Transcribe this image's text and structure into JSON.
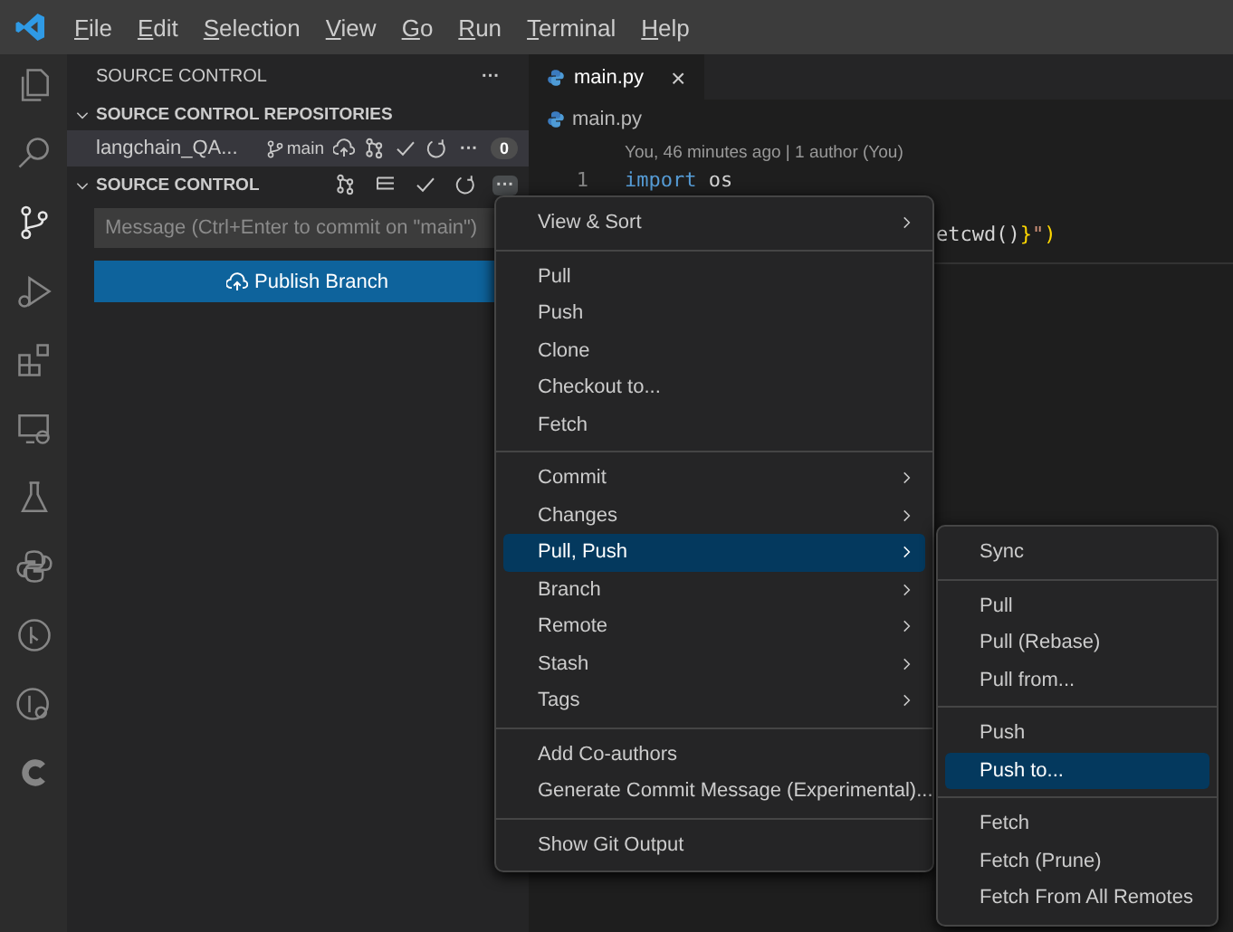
{
  "title_bar": {
    "menus": [
      "File",
      "Edit",
      "Selection",
      "View",
      "Go",
      "Run",
      "Terminal",
      "Help"
    ]
  },
  "activity_bar": {
    "items": [
      {
        "selected": false
      },
      {
        "selected": false
      },
      {
        "selected": true
      },
      {
        "selected": false
      },
      {
        "selected": false
      },
      {
        "selected": false
      },
      {
        "selected": false
      },
      {
        "selected": false
      },
      {
        "selected": false
      },
      {
        "selected": false
      },
      {
        "selected": false
      }
    ]
  },
  "sidebar": {
    "title": "SOURCE CONTROL",
    "title_more": "···",
    "repositories": {
      "header": "SOURCE CONTROL REPOSITORIES",
      "repo": {
        "name": "langchain_QA...",
        "branch": "main",
        "more": "···",
        "count": "0"
      }
    },
    "source_control": {
      "header": "SOURCE CONTROL",
      "more": "···",
      "message": {
        "placeholder": "Message (Ctrl+Enter to commit on \"main\")"
      },
      "publish_button": "Publish Branch"
    }
  },
  "editor": {
    "tab": {
      "label": "main.py",
      "close": "×"
    },
    "breadcrumb": "main.py",
    "blame": "You, 46 minutes ago | 1 author (You)",
    "lines": [
      {
        "number": "1",
        "tokens": [
          {
            "text": "import",
            "kind": "keyword"
          },
          {
            "text": " os",
            "kind": "plain"
          }
        ]
      },
      {
        "tokens": [
          {
            "text": "etcwd()",
            "kind": "plain"
          },
          {
            "text": "}",
            "kind": "bracket"
          },
          {
            "text": "\"",
            "kind": "string"
          },
          {
            "text": ")",
            "kind": "bracket"
          }
        ]
      }
    ]
  },
  "context_menu": {
    "groups": [
      [
        {
          "label": "View & Sort",
          "submenu": true,
          "selected": false
        }
      ],
      [
        {
          "label": "Pull",
          "submenu": false,
          "selected": false
        },
        {
          "label": "Push",
          "submenu": false,
          "selected": false
        },
        {
          "label": "Clone",
          "submenu": false,
          "selected": false
        },
        {
          "label": "Checkout to...",
          "submenu": false,
          "selected": false
        },
        {
          "label": "Fetch",
          "submenu": false,
          "selected": false
        }
      ],
      [
        {
          "label": "Commit",
          "submenu": true,
          "selected": false
        },
        {
          "label": "Changes",
          "submenu": true,
          "selected": false
        },
        {
          "label": "Pull, Push",
          "submenu": true,
          "selected": true
        },
        {
          "label": "Branch",
          "submenu": true,
          "selected": false
        },
        {
          "label": "Remote",
          "submenu": true,
          "selected": false
        },
        {
          "label": "Stash",
          "submenu": true,
          "selected": false
        },
        {
          "label": "Tags",
          "submenu": true,
          "selected": false
        }
      ],
      [
        {
          "label": "Add Co-authors",
          "submenu": false,
          "selected": false
        },
        {
          "label": "Generate Commit Message (Experimental)...",
          "submenu": false,
          "selected": false
        }
      ],
      [
        {
          "label": "Show Git Output",
          "submenu": false,
          "selected": false
        }
      ]
    ]
  },
  "submenu": {
    "groups": [
      [
        {
          "label": "Sync",
          "submenu": false,
          "selected": false
        }
      ],
      [
        {
          "label": "Pull",
          "submenu": false,
          "selected": false
        },
        {
          "label": "Pull (Rebase)",
          "submenu": false,
          "selected": false
        },
        {
          "label": "Pull from...",
          "submenu": false,
          "selected": false
        }
      ],
      [
        {
          "label": "Push",
          "submenu": false,
          "selected": false
        },
        {
          "label": "Push to...",
          "submenu": false,
          "selected": true
        }
      ],
      [
        {
          "label": "Fetch",
          "submenu": false,
          "selected": false
        },
        {
          "label": "Fetch (Prune)",
          "submenu": false,
          "selected": false
        },
        {
          "label": "Fetch From All Remotes",
          "submenu": false,
          "selected": false
        }
      ]
    ]
  }
}
